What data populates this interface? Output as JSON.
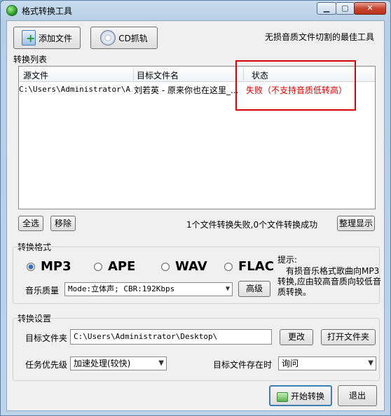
{
  "window": {
    "title": "格式转换工具",
    "controls": {
      "minimize": "▁",
      "maximize": "▢",
      "close": "✕"
    }
  },
  "toolbar": {
    "add_file_label": "添加文件",
    "cd_rip_label": "CD抓轨",
    "tagline": "无损音质文件切割的最佳工具"
  },
  "list": {
    "group_label": "转换列表",
    "columns": [
      "源文件",
      "目标文件名",
      "状态"
    ],
    "rows": [
      {
        "source": "C:\\Users\\Administrator\\A...",
        "target": "刘若英 - 原来你也在这里_...",
        "status": "失败（不支持音质低转高）"
      }
    ],
    "select_all": "全选",
    "remove": "移除",
    "summary": "1个文件转换失败,0个文件转换成功",
    "tidy_display": "整理显示"
  },
  "format": {
    "group_label": "转换格式",
    "options": [
      "MP3",
      "APE",
      "WAV",
      "FLAC"
    ],
    "selected": "MP3",
    "quality_label": "音乐质量",
    "quality_value": "Mode:立体声; CBR:192Kbps",
    "advanced_label": "高级",
    "hint_title": "提示:",
    "hint_body": "有损音乐格式歌曲向MP3转换,应由较高音质向较低音质转换。"
  },
  "settings": {
    "group_label": "转换设置",
    "target_folder_label": "目标文件夹",
    "target_folder_value": "C:\\Users\\Administrator\\Desktop\\",
    "change_label": "更改",
    "open_folder_label": "打开文件夹",
    "priority_label": "任务优先级",
    "priority_value": "加速处理(较快)",
    "exists_label": "目标文件存在时",
    "exists_value": "询问"
  },
  "actions": {
    "start_label": "开始转换",
    "exit_label": "退出"
  }
}
